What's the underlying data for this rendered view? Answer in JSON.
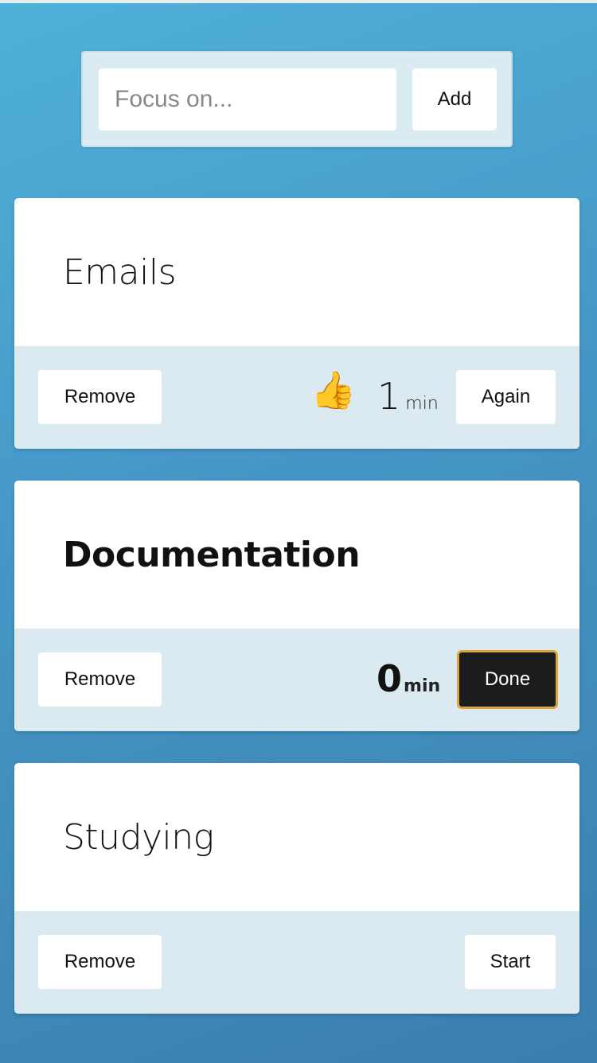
{
  "add_panel": {
    "input_placeholder": "Focus on...",
    "add_label": "Add"
  },
  "tasks": [
    {
      "title": "Emails",
      "remove_label": "Remove",
      "status_icon": "thumbs-up-icon",
      "status_glyph": "👍",
      "time_value": "1",
      "time_unit": "min",
      "action_label": "Again"
    },
    {
      "title": "Documentation",
      "remove_label": "Remove",
      "time_value": "0",
      "time_unit": "min",
      "action_label": "Done"
    },
    {
      "title": "Studying",
      "remove_label": "Remove",
      "action_label": "Start"
    }
  ],
  "colors": {
    "background_start": "#4fb1d9",
    "background_end": "#3a7fae",
    "footer": "#dbe9f1",
    "done_button": "#1b1c1e",
    "done_border": "#e0a53a"
  }
}
